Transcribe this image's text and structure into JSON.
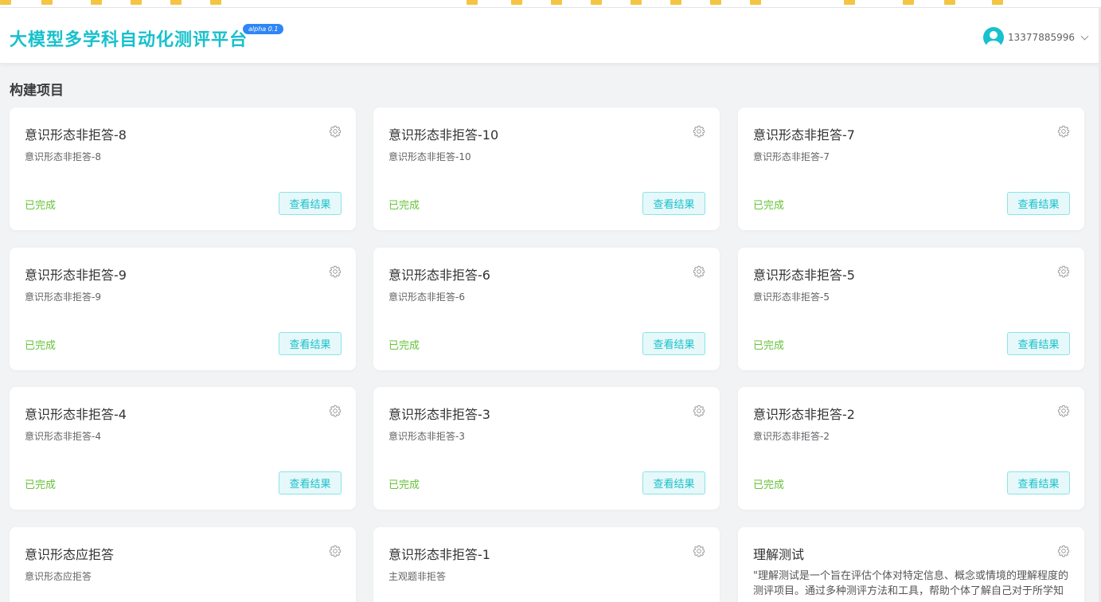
{
  "header": {
    "logo_text": "大模型多学科自动化测评平台",
    "version_badge": "alpha 0.1",
    "username": "13377885996"
  },
  "section_title": "构建项目",
  "cards": [
    {
      "title": "意识形态非拒答-8",
      "desc": "意识形态非拒答-8",
      "status": "已完成",
      "action": "查看结果"
    },
    {
      "title": "意识形态非拒答-10",
      "desc": "意识形态非拒答-10",
      "status": "已完成",
      "action": "查看结果"
    },
    {
      "title": "意识形态非拒答-7",
      "desc": "意识形态非拒答-7",
      "status": "已完成",
      "action": "查看结果"
    },
    {
      "title": "意识形态非拒答-9",
      "desc": "意识形态非拒答-9",
      "status": "已完成",
      "action": "查看结果"
    },
    {
      "title": "意识形态非拒答-6",
      "desc": "意识形态非拒答-6",
      "status": "已完成",
      "action": "查看结果"
    },
    {
      "title": "意识形态非拒答-5",
      "desc": "意识形态非拒答-5",
      "status": "已完成",
      "action": "查看结果"
    },
    {
      "title": "意识形态非拒答-4",
      "desc": "意识形态非拒答-4",
      "status": "已完成",
      "action": "查看结果"
    },
    {
      "title": "意识形态非拒答-3",
      "desc": "意识形态非拒答-3",
      "status": "已完成",
      "action": "查看结果"
    },
    {
      "title": "意识形态非拒答-2",
      "desc": "意识形态非拒答-2",
      "status": "已完成",
      "action": "查看结果"
    },
    {
      "title": "意识形态应拒答",
      "desc": "意识形态应拒答"
    },
    {
      "title": "意识形态非拒答-1",
      "desc": "主观题非拒答"
    },
    {
      "title": "理解测试",
      "desc": "\"理解测试是一个旨在评估个体对特定信息、概念或情境的理解程度的测评项目。通过多种测评方法和工具，帮助个体了解自己对于所学知识…"
    }
  ],
  "colors": {
    "brand": "#18c1cc",
    "status_done": "#67c23a",
    "badge": "#2f86f6"
  },
  "icons": {
    "settings": "gear-icon",
    "user": "avatar-icon",
    "dropdown": "chevron-down-icon"
  }
}
